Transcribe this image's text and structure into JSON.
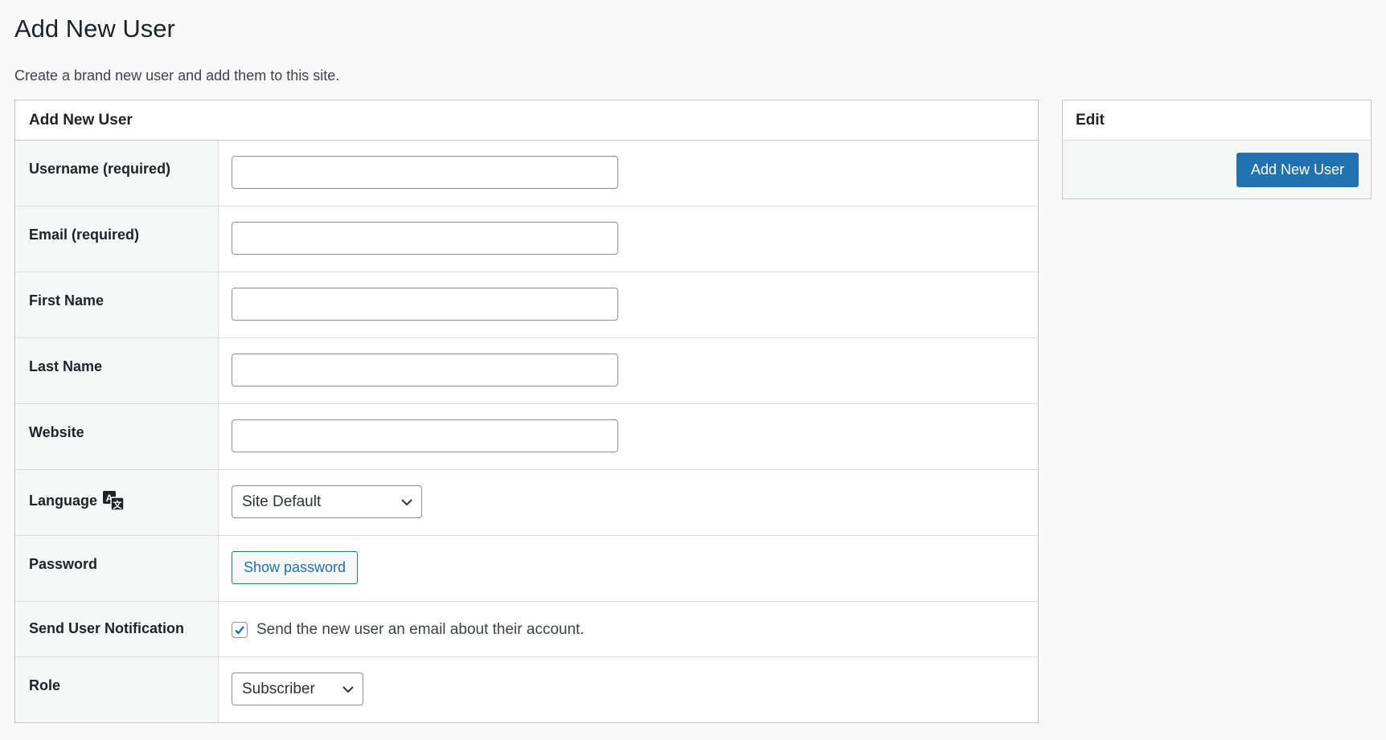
{
  "page": {
    "title": "Add New User",
    "description": "Create a brand new user and add them to this site."
  },
  "form": {
    "header": "Add New User",
    "fields": {
      "username": {
        "label": "Username (required)",
        "value": ""
      },
      "email": {
        "label": "Email (required)",
        "value": ""
      },
      "first_name": {
        "label": "First Name",
        "value": ""
      },
      "last_name": {
        "label": "Last Name",
        "value": ""
      },
      "website": {
        "label": "Website",
        "value": ""
      },
      "language": {
        "label": "Language",
        "selected": "Site Default",
        "icon": "translate-icon"
      },
      "password": {
        "label": "Password",
        "button": "Show password"
      },
      "notification": {
        "label": "Send User Notification",
        "checkbox_label": "Send the new user an email about their account.",
        "checked": true
      },
      "role": {
        "label": "Role",
        "selected": "Subscriber"
      }
    }
  },
  "sidebar": {
    "header": "Edit",
    "submit_label": "Add New User"
  },
  "colors": {
    "accent": "#2271b1",
    "border": "#c3c4c7",
    "label_bg": "#f6f7f7"
  }
}
